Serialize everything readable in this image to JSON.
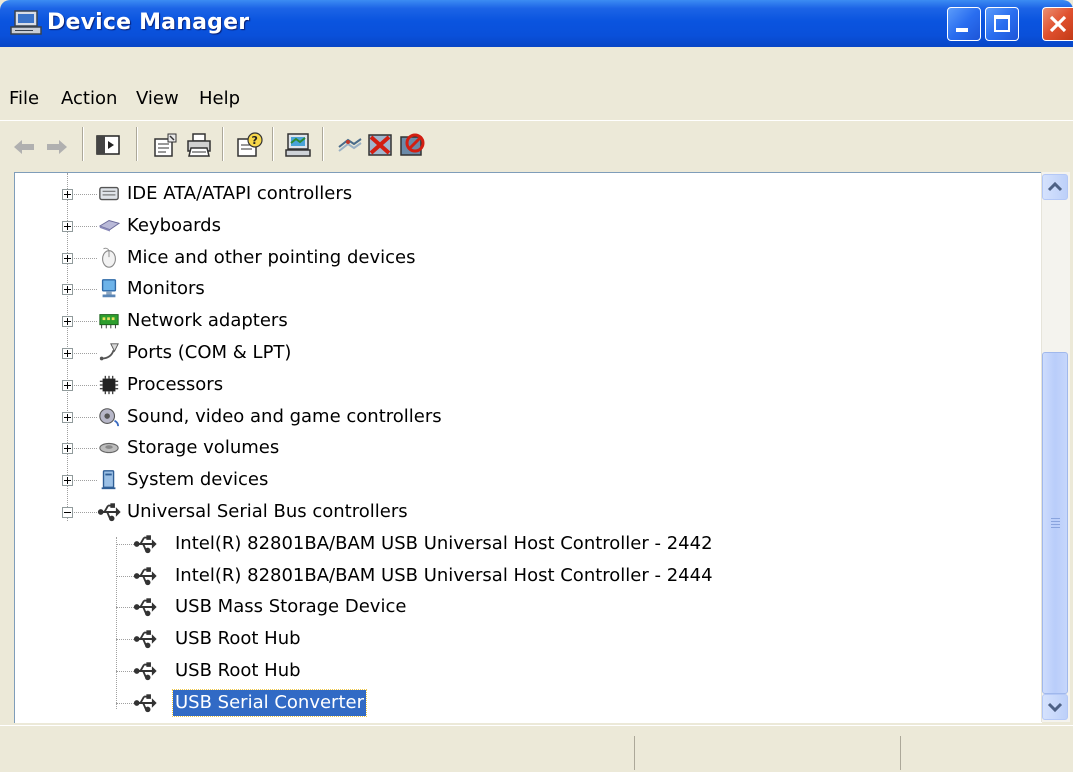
{
  "window": {
    "title": "Device Manager",
    "title_icon": "computer-monitor-icon",
    "controls": [
      "minimize-icon",
      "maximize-icon",
      "close-icon"
    ]
  },
  "menu": {
    "items": [
      "File",
      "Action",
      "View",
      "Help"
    ]
  },
  "toolbar": {
    "buttons": [
      "back-arrow-icon",
      "forward-arrow-icon",
      "show-hide-console-tree-icon",
      "properties-icon",
      "print-icon",
      "help-icon",
      "scan-hardware-icon",
      "update-driver-icon",
      "uninstall-icon",
      "disable-icon"
    ]
  },
  "tree": {
    "categories": [
      {
        "label": "IDE ATA/ATAPI controllers",
        "icon": "ide-controller-icon",
        "expanded": false
      },
      {
        "label": "Keyboards",
        "icon": "keyboard-icon",
        "expanded": false
      },
      {
        "label": "Mice and other pointing devices",
        "icon": "mouse-icon",
        "expanded": false
      },
      {
        "label": "Monitors",
        "icon": "monitor-icon",
        "expanded": false
      },
      {
        "label": "Network adapters",
        "icon": "network-adapter-icon",
        "expanded": false
      },
      {
        "label": "Ports (COM & LPT)",
        "icon": "port-icon",
        "expanded": false
      },
      {
        "label": "Processors",
        "icon": "processor-icon",
        "expanded": false
      },
      {
        "label": "Sound, video and game controllers",
        "icon": "sound-icon",
        "expanded": false
      },
      {
        "label": "Storage volumes",
        "icon": "storage-volume-icon",
        "expanded": false
      },
      {
        "label": "System devices",
        "icon": "system-devices-icon",
        "expanded": false
      },
      {
        "label": "Universal Serial Bus controllers",
        "icon": "usb-icon",
        "expanded": true
      }
    ],
    "usb_children": [
      {
        "label": "Intel(R) 82801BA/BAM USB Universal Host Controller - 2442",
        "selected": false
      },
      {
        "label": "Intel(R) 82801BA/BAM USB Universal Host Controller - 2444",
        "selected": false
      },
      {
        "label": "USB Mass Storage Device",
        "selected": false
      },
      {
        "label": "USB Root Hub",
        "selected": false
      },
      {
        "label": "USB Root Hub",
        "selected": false
      },
      {
        "label": "USB Serial Converter",
        "selected": true
      }
    ]
  },
  "colors": {
    "titlebar": "#0a54df",
    "selection": "#316ac5",
    "chrome": "#ece9d8"
  }
}
